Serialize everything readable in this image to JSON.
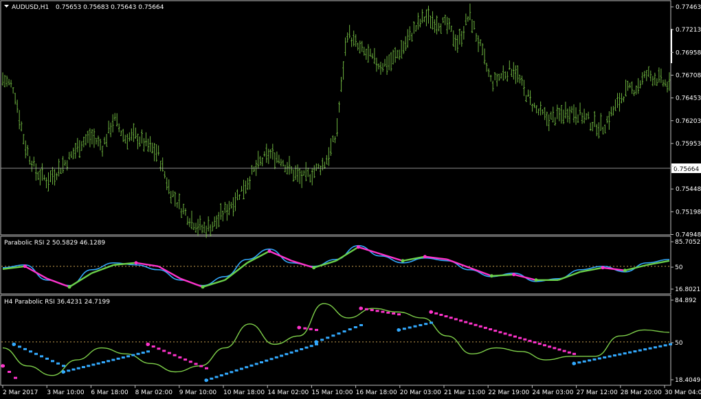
{
  "window": {
    "symbol_label": "AUDUSD,H1",
    "ohlc": "0.75653 0.75683 0.75643 0.75664",
    "current_price": "0.75664",
    "menu_icon": "triangle-down-icon"
  },
  "colors": {
    "background": "#000000",
    "border": "#c0c0c0",
    "price_bars": "#6db33f",
    "fast_line": "#33aaff",
    "slow_line": "#77d14a",
    "h4_line": "#7fd14a",
    "sar_up": "#6bd14a",
    "sar_down": "#ff33cc",
    "h4_sar_up": "#33aaff",
    "h4_sar_down": "#ff33cc",
    "level_line": "#c8a050",
    "text": "#ffffff"
  },
  "price_axis": [
    "0.77463",
    "0.77213",
    "0.76958",
    "0.76708",
    "0.76453",
    "0.76203",
    "0.75953",
    "0.75703",
    "0.75448",
    "0.75198",
    "0.74948"
  ],
  "time_axis": [
    "2 Mar 2017",
    "3 Mar 10:00",
    "6 Mar 18:00",
    "8 Mar 02:00",
    "9 Mar 10:00",
    "10 Mar 18:00",
    "14 Mar 02:00",
    "15 Mar 10:00",
    "16 Mar 18:00",
    "20 Mar 03:00",
    "21 Mar 11:00",
    "22 Mar 19:00",
    "24 Mar 03:00",
    "27 Mar 12:00",
    "28 Mar 20:00",
    "30 Mar 04:00"
  ],
  "indicator1": {
    "label": "Parabolic RSI 2 50.5829 46.1289",
    "axis": [
      "85.7052",
      "50",
      "16.8021"
    ]
  },
  "indicator2": {
    "label": "H4 Parabolic RSI 36.4231 24.7199",
    "axis": [
      "84.892",
      "50",
      "18.4049"
    ]
  },
  "chart_data": [
    {
      "type": "ohlc",
      "title": "AUDUSD,H1",
      "ylim": [
        0.749,
        0.7748
      ],
      "x": [
        "2 Mar 2017",
        "3 Mar 10:00",
        "6 Mar 18:00",
        "8 Mar 02:00",
        "9 Mar 10:00",
        "10 Mar 18:00",
        "14 Mar 02:00",
        "15 Mar 10:00",
        "16 Mar 18:00",
        "20 Mar 03:00",
        "21 Mar 11:00",
        "22 Mar 19:00",
        "24 Mar 03:00",
        "27 Mar 12:00",
        "28 Mar 20:00",
        "30 Mar 04:00"
      ],
      "close_path": [
        0.7665,
        0.7655,
        0.759,
        0.756,
        0.755,
        0.7562,
        0.7575,
        0.7592,
        0.76,
        0.7588,
        0.762,
        0.7598,
        0.76,
        0.759,
        0.758,
        0.754,
        0.752,
        0.7505,
        0.7495,
        0.75,
        0.7515,
        0.753,
        0.7548,
        0.7568,
        0.758,
        0.7575,
        0.756,
        0.7552,
        0.756,
        0.757,
        0.76,
        0.7718,
        0.77,
        0.769,
        0.768,
        0.7685,
        0.77,
        0.772,
        0.7735,
        0.773,
        0.7725,
        0.7705,
        0.7738,
        0.77,
        0.766,
        0.767,
        0.7678,
        0.765,
        0.763,
        0.762,
        0.7622,
        0.763,
        0.7625,
        0.7615,
        0.761,
        0.763,
        0.765,
        0.7655,
        0.767,
        0.7665,
        0.7656
      ],
      "last_price": 0.75664
    },
    {
      "type": "line",
      "title": "Parabolic RSI 2",
      "values_shown": [
        50.5829,
        46.1289
      ],
      "ylim": [
        16.8021,
        85.7052
      ],
      "level": 50,
      "series": [
        {
          "values": [
            48,
            52,
            30,
            22,
            45,
            55,
            52,
            45,
            30,
            22,
            35,
            60,
            75,
            55,
            50,
            60,
            80,
            65,
            55,
            62,
            58,
            45,
            35,
            40,
            28,
            32,
            45,
            50,
            42,
            55,
            60
          ]
        },
        {
          "values": [
            46,
            50,
            32,
            20,
            40,
            52,
            55,
            50,
            32,
            20,
            30,
            55,
            72,
            58,
            48,
            58,
            78,
            68,
            58,
            64,
            60,
            48,
            36,
            38,
            30,
            30,
            42,
            48,
            44,
            52,
            58
          ]
        }
      ]
    },
    {
      "type": "line",
      "title": "H4 Parabolic RSI",
      "values_shown": [
        36.4231,
        24.7199
      ],
      "ylim": [
        18.4049,
        84.892
      ],
      "level": 50,
      "series": [
        {
          "values": [
            45,
            30,
            22,
            35,
            45,
            40,
            32,
            25,
            30,
            45,
            65,
            48,
            55,
            82,
            70,
            78,
            75,
            70,
            55,
            40,
            45,
            42,
            35,
            38,
            38,
            55,
            60,
            58
          ]
        }
      ]
    }
  ]
}
